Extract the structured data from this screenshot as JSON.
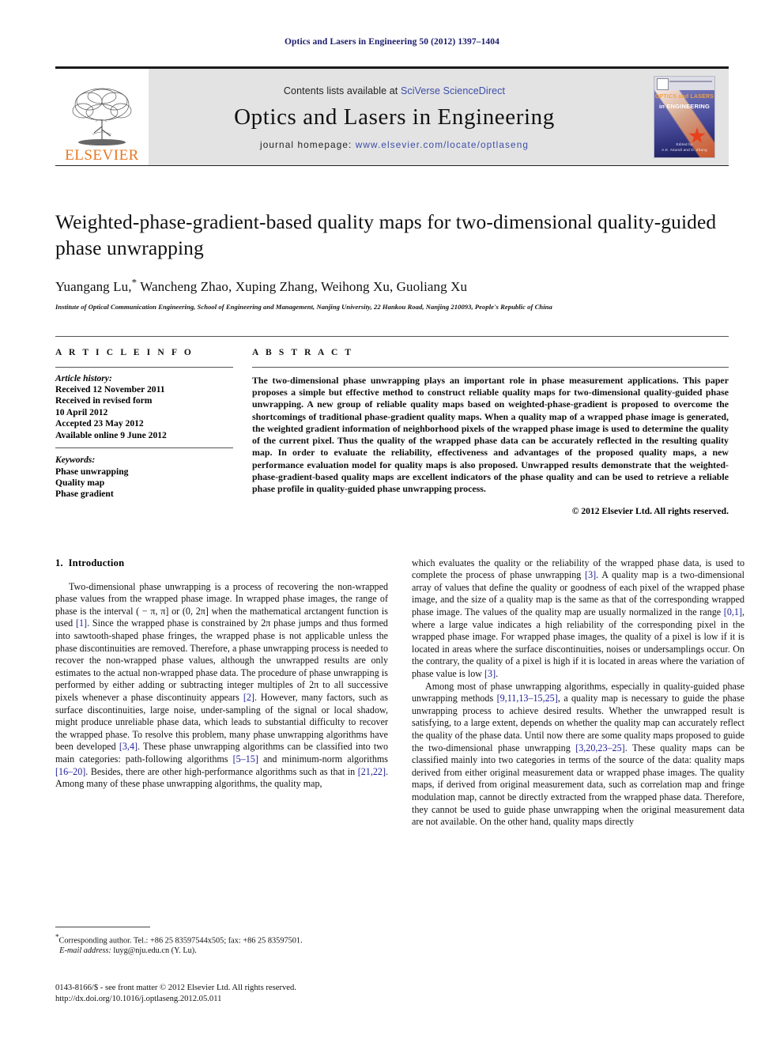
{
  "running_head": "Optics and Lasers in Engineering 50 (2012) 1397–1404",
  "masthead": {
    "publisher_name": "ELSEVIER",
    "contents_prefix": "Contents lists available at ",
    "contents_link": "SciVerse ScienceDirect",
    "journal_title": "Optics and Lasers in Engineering",
    "homepage_label": "journal homepage: ",
    "homepage_url": "www.elsevier.com/locate/optlaseng",
    "cover": {
      "line1": "OPTICS and LASERS",
      "line2": "in ENGINEERING",
      "editor_line1": "Edited by",
      "editor_line2": "A.K. Asundi and D. Zhang"
    }
  },
  "article": {
    "title": "Weighted-phase-gradient-based quality maps for two-dimensional quality-guided phase unwrapping",
    "authors": "Yuangang Lu, Wancheng Zhao, Xuping Zhang, Weihong Xu, Guoliang Xu",
    "corresponding_marker": "*",
    "affiliation": "Institute of Optical Communication Engineering, School of Engineering and Management, Nanjing University, 22 Hankou Road, Nanjing 210093, People's Republic of China"
  },
  "article_info": {
    "heading": "A R T I C L E   I N F O",
    "history_label": "Article history:",
    "history": [
      "Received 12 November 2011",
      "Received in revised form",
      "10 April 2012",
      "Accepted 23 May 2012",
      "Available online 9 June 2012"
    ],
    "keywords_label": "Keywords:",
    "keywords": [
      "Phase unwrapping",
      "Quality map",
      "Phase gradient"
    ]
  },
  "abstract": {
    "heading": "A B S T R A C T",
    "text": "The two-dimensional phase unwrapping plays an important role in phase measurement applications. This paper proposes a simple but effective method to construct reliable quality maps for two-dimensional quality-guided phase unwrapping. A new group of reliable quality maps based on weighted-phase-gradient is proposed to overcome the shortcomings of traditional phase-gradient quality maps. When a quality map of a wrapped phase image is generated, the weighted gradient information of neighborhood pixels of the wrapped phase image is used to determine the quality of the current pixel. Thus the quality of the wrapped phase data can be accurately reflected in the resulting quality map. In order to evaluate the reliability, effectiveness and advantages of the proposed quality maps, a new performance evaluation model for quality maps is also proposed. Unwrapped results demonstrate that the weighted-phase-gradient-based quality maps are excellent indicators of the phase quality and can be used to retrieve a reliable phase profile in quality-guided phase unwrapping process.",
    "copyright": "© 2012 Elsevier Ltd. All rights reserved."
  },
  "introduction": {
    "number": "1.",
    "heading": "Introduction",
    "left_paragraph_1": "Two-dimensional phase unwrapping is a process of recovering the non-wrapped phase values from the wrapped phase image. In wrapped phase images, the range of phase is the interval ( − π, π] or (0, 2π] when the mathematical arctangent function is used [1]. Since the wrapped phase is constrained by 2π phase jumps and thus formed into sawtooth-shaped phase fringes, the wrapped phase is not applicable unless the phase discontinuities are removed. Therefore, a phase unwrapping process is needed to recover the non-wrapped phase values, although the unwrapped results are only estimates to the actual non-wrapped phase data. The procedure of phase unwrapping is performed by either adding or subtracting integer multiples of 2π to all successive pixels whenever a phase discontinuity appears [2]. However, many factors, such as surface discontinuities, large noise, under-sampling of the signal or local shadow, might produce unreliable phase data, which leads to substantial difficulty to recover the wrapped phase. To resolve this problem, many phase unwrapping algorithms have been developed [3,4]. These phase unwrapping algorithms can be classified into two main categories: path-following algorithms [5–15] and minimum-norm algorithms [16–20]. Besides, there are other high-performance algorithms such as that in [21,22]. Among many of these phase unwrapping algorithms, the quality map,",
    "right_paragraph_1": "which evaluates the quality or the reliability of the wrapped phase data, is used to complete the process of phase unwrapping [3]. A quality map is a two-dimensional array of values that define the quality or goodness of each pixel of the wrapped phase image, and the size of a quality map is the same as that of the corresponding wrapped phase image. The values of the quality map are usually normalized in the range [0,1], where a large value indicates a high reliability of the corresponding pixel in the wrapped phase image. For wrapped phase images, the quality of a pixel is low if it is located in areas where the surface discontinuities, noises or undersamplings occur. On the contrary, the quality of a pixel is high if it is located in areas where the variation of phase value is low [3].",
    "right_paragraph_2": "Among most of phase unwrapping algorithms, especially in quality-guided phase unwrapping methods [9,11,13–15,25], a quality map is necessary to guide the phase unwrapping process to achieve desired results. Whether the unwrapped result is satisfying, to a large extent, depends on whether the quality map can accurately reflect the quality of the phase data. Until now there are some quality maps proposed to guide the two-dimensional phase unwrapping [3,20,23–25]. These quality maps can be classified mainly into two categories in terms of the source of the data: quality maps derived from either original measurement data or wrapped phase images. The quality maps, if derived from original measurement data, such as correlation map and fringe modulation map, cannot be directly extracted from the wrapped phase data. Therefore, they cannot be used to guide phase unwrapping when the original measurement data are not available. On the other hand, quality maps directly"
  },
  "footnote": {
    "corresponding": "Corresponding author. Tel.: +86 25 83597544x505; fax: +86 25 83597501.",
    "email_label": "E-mail address:",
    "email": "luyg@nju.edu.cn (Y. Lu)."
  },
  "imprint": {
    "line1": "0143-8166/$ - see front matter © 2012 Elsevier Ltd. All rights reserved.",
    "line2": "http://dx.doi.org/10.1016/j.optlaseng.2012.05.011"
  },
  "colors": {
    "running_head": "#1a1a6e",
    "link": "#3b4ea8",
    "reference": "#21219c",
    "elsevier_orange": "#E87722",
    "masthead_bg": "#e3e3e3"
  }
}
